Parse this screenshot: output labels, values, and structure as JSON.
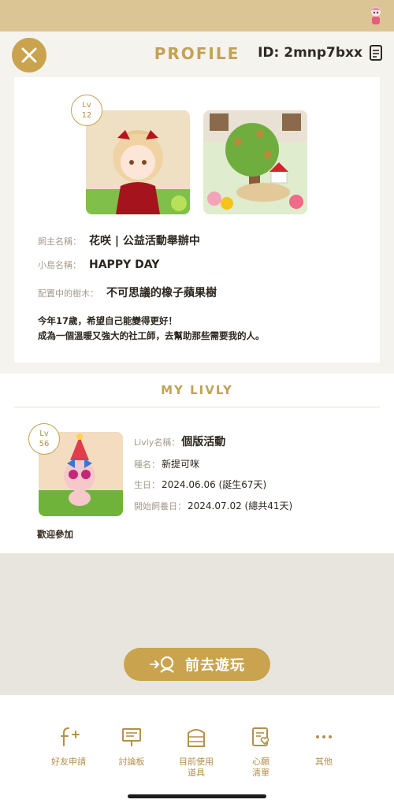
{
  "header": {
    "title": "PROFILE",
    "id_text": "ID: 2mnp7bxx"
  },
  "owner": {
    "level_label": "Lv",
    "level": "12",
    "fields": [
      {
        "label": "飼主名稱：",
        "value": "花咲 | 公益活動舉辦中"
      },
      {
        "label": "小島名稱：",
        "value": "HAPPY DAY"
      },
      {
        "label": "配置中的樹木：",
        "value": "不可思議的橡子蘋果樹"
      }
    ],
    "bio_line1": "今年17歲，希望自己能變得更好！",
    "bio_line2": "成為一個溫暖又強大的社工師，去幫助那些需要我的人。"
  },
  "livly": {
    "section_title": "MY LIVLY",
    "level_label": "Lv",
    "level": "56",
    "fields": [
      {
        "label": "Livly名稱：",
        "value": "個版活動"
      },
      {
        "label": "種名：",
        "value": "新提可咪"
      },
      {
        "label": "生日：",
        "value": "2024.06.06 (誕生67天)"
      },
      {
        "label": "開始飼養日：",
        "value": "2024.07.02 (總共41天)"
      }
    ],
    "comment": "歡迎參加"
  },
  "play_button": {
    "label": "前去遊玩"
  },
  "nav": [
    {
      "label": "好友申請",
      "icon": "friend-request-icon"
    },
    {
      "label": "討論板",
      "icon": "board-icon"
    },
    {
      "label": "目前使用\n道具",
      "icon": "locker-icon"
    },
    {
      "label": "心願\n清單",
      "icon": "wishlist-icon"
    },
    {
      "label": "其他",
      "icon": "more-icon"
    }
  ],
  "colors": {
    "accent": "#c9a34d",
    "topbar": "#dcc594",
    "label": "#a69b8c",
    "nav_text": "#b3904a"
  }
}
